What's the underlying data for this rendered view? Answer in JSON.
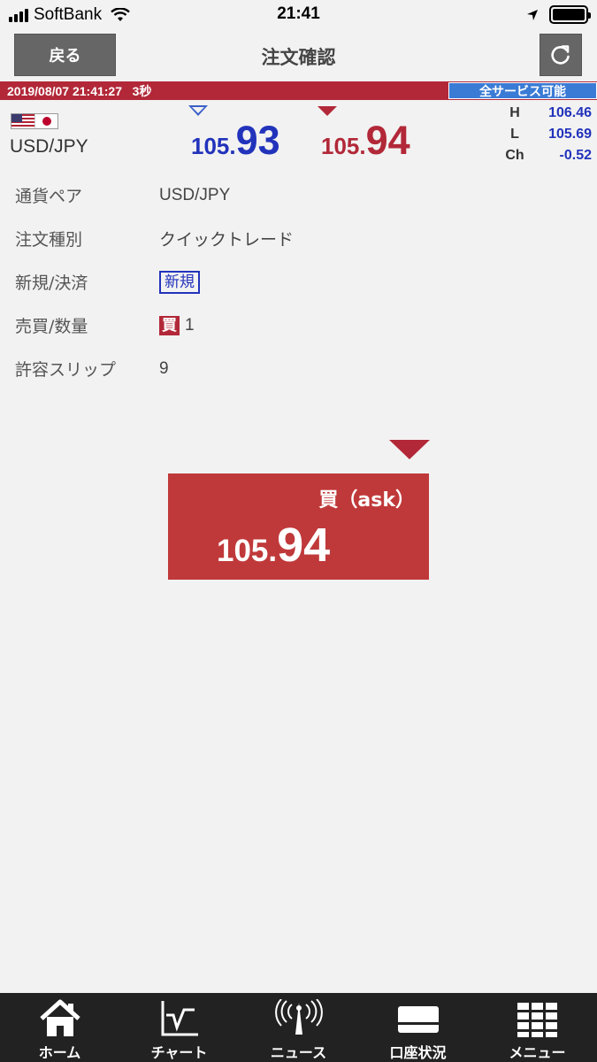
{
  "status_bar": {
    "carrier": "SoftBank",
    "time": "21:41"
  },
  "header": {
    "back_label": "戻る",
    "title": "注文確認"
  },
  "info_bar": {
    "datetime": "2019/08/07 21:41:27",
    "interval": "3秒",
    "service_status": "全サービス可能"
  },
  "quote": {
    "pair": "USD/JPY",
    "bid_prefix": "105.",
    "bid_main": "93",
    "ask_prefix": "105.",
    "ask_main": "94",
    "high_label": "H",
    "high": "106.46",
    "low_label": "L",
    "low": "105.69",
    "change_label": "Ch",
    "change": "-0.52",
    "bid_color": "#2233bb",
    "ask_color": "#b22838"
  },
  "details": {
    "pair_label": "通貨ペア",
    "pair_value": "USD/JPY",
    "order_type_label": "注文種別",
    "order_type_value": "クイックトレード",
    "new_close_label": "新規/決済",
    "new_close_value": "新規",
    "side_qty_label": "売買/数量",
    "side_value": "買",
    "qty_value": "1",
    "slippage_label": "許容スリップ",
    "slippage_value": "9"
  },
  "buy_button": {
    "label": "買（ask）",
    "price_prefix": "105.",
    "price_main": "94"
  },
  "tab_bar": {
    "items": [
      {
        "label": "ホーム",
        "icon": "home-icon"
      },
      {
        "label": "チャート",
        "icon": "chart-icon"
      },
      {
        "label": "ニュース",
        "icon": "news-icon"
      },
      {
        "label": "口座状況",
        "icon": "account-icon"
      },
      {
        "label": "メニュー",
        "icon": "menu-icon"
      }
    ]
  }
}
